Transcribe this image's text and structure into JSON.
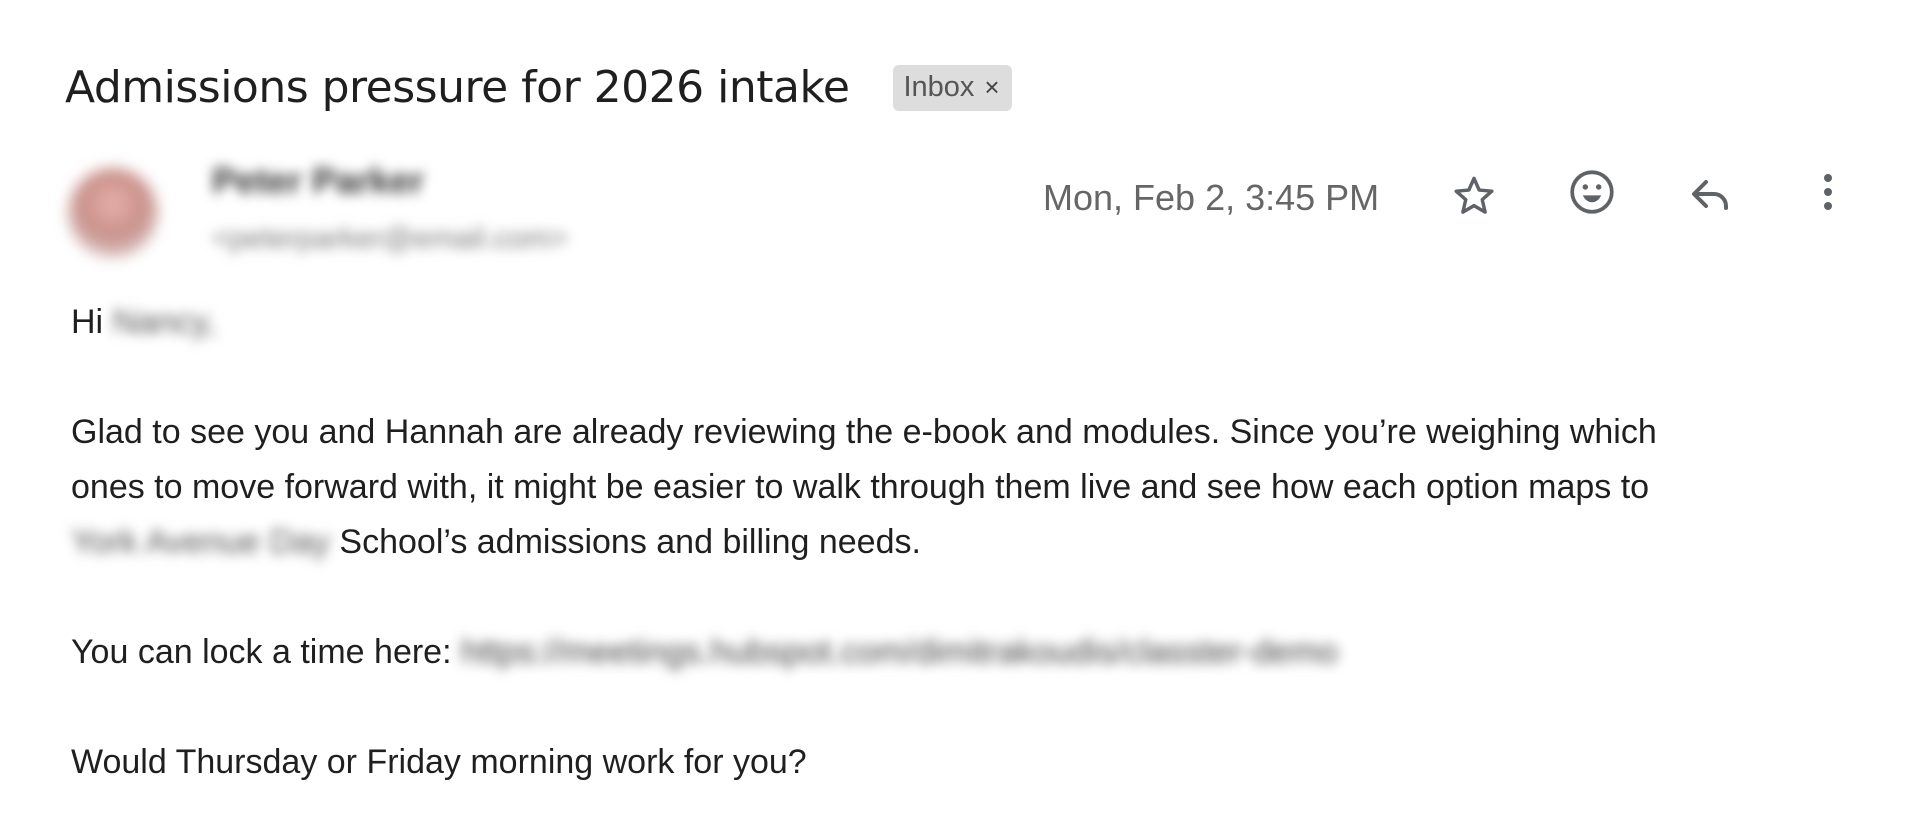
{
  "email": {
    "subject": "Admissions pressure for 2026 intake",
    "label": "Inbox",
    "label_remove": "×",
    "sender_name": "Peter Parker",
    "sender_email": "<peterparker@email.com>",
    "date": "Mon, Feb 2, 3:45 PM",
    "icons": [
      "star-icon",
      "emoji-icon",
      "reply-icon",
      "more-vert-icon"
    ],
    "body": {
      "greeting_prefix": "Hi",
      "greeting_name": "Nancy,",
      "p1_line1": "Glad to see you and Hannah are already reviewing the e-book and modules. Since you’re weighing which",
      "p1_line2": "ones to move forward with, it might be easier to walk through them live and see how each option maps to",
      "p1_school": "York Avenue Day",
      "p1_line3_rest": " School’s admissions and billing needs.",
      "p2_prefix": "You can lock a time here: ",
      "p2_link": "https://meetings.hubspot.com/dimitrakoudis/classter-demo",
      "p3": "Would Thursday or Friday morning work for you?"
    }
  },
  "colors": {
    "chip_bg": "#dddddd",
    "text": "#1f1f1f",
    "muted": "#666666",
    "icon": "#5f6368"
  }
}
